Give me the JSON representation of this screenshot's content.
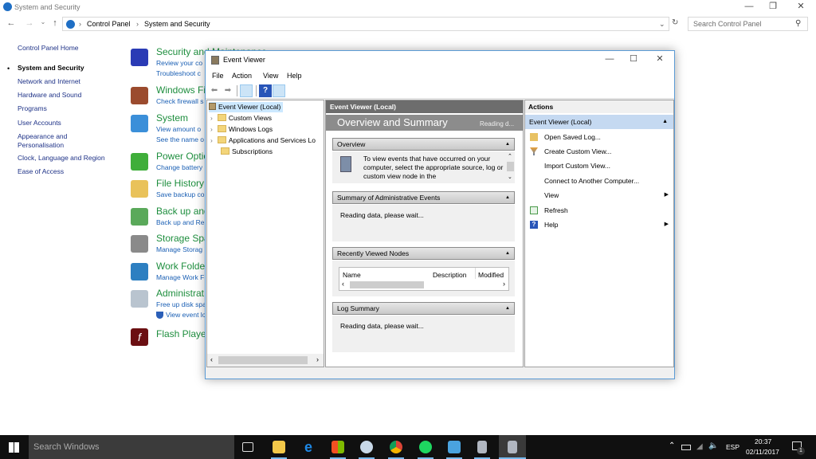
{
  "control_panel": {
    "window_title": "System and Security",
    "breadcrumb": [
      "Control Panel",
      "System and Security"
    ],
    "search_placeholder": "Search Control Panel",
    "left_nav": [
      {
        "label": "Control Panel Home",
        "selected": false
      },
      {
        "label": "System and Security",
        "selected": true
      },
      {
        "label": "Network and Internet",
        "selected": false
      },
      {
        "label": "Hardware and Sound",
        "selected": false
      },
      {
        "label": "Programs",
        "selected": false
      },
      {
        "label": "User Accounts",
        "selected": false
      },
      {
        "label": "Appearance and",
        "selected": false
      },
      {
        "label": "Personalisation",
        "selected": false
      },
      {
        "label": "Clock, Language and Region",
        "selected": false
      },
      {
        "label": "Ease of Access",
        "selected": false
      }
    ],
    "categories": [
      {
        "title": "Security and Maintenance",
        "links": [
          "Review your co",
          "Troubleshoot c"
        ]
      },
      {
        "title": "Windows Fi",
        "links": [
          "Check firewall s"
        ]
      },
      {
        "title": "System",
        "links": [
          "View amount o",
          "See the name o"
        ]
      },
      {
        "title": "Power Optio",
        "links": [
          "Change battery"
        ]
      },
      {
        "title": "File History",
        "links": [
          "Save backup co"
        ]
      },
      {
        "title": "Back up and",
        "links": [
          "Back up and Re"
        ]
      },
      {
        "title": "Storage Spa",
        "links": [
          "Manage Storag"
        ]
      },
      {
        "title": "Work Folde",
        "links": [
          "Manage Work F"
        ]
      },
      {
        "title": "Administrat",
        "links": [
          "Free up disk spa",
          "View event lo"
        ]
      },
      {
        "title": "Flash Player",
        "links": []
      }
    ]
  },
  "event_viewer": {
    "title": "Event Viewer",
    "menu": [
      "File",
      "Action",
      "View",
      "Help"
    ],
    "tree": [
      {
        "label": "Event Viewer (Local)",
        "expandable": false,
        "selected": true
      },
      {
        "label": "Custom Views",
        "expandable": true
      },
      {
        "label": "Windows Logs",
        "expandable": true
      },
      {
        "label": "Applications and Services Lo",
        "expandable": true
      },
      {
        "label": "Subscriptions",
        "expandable": false
      }
    ],
    "center": {
      "header": "Event Viewer (Local)",
      "banner_title": "Overview and Summary",
      "banner_status": "Reading d...",
      "sections": [
        {
          "title": "Overview",
          "body": "To view events that have occurred on your computer, select the appropriate source, log or custom view node in the"
        },
        {
          "title": "Summary of Administrative Events",
          "body": "Reading data, please wait..."
        },
        {
          "title": "Recently Viewed Nodes",
          "columns": [
            "Name",
            "Description",
            "Modified"
          ]
        },
        {
          "title": "Log Summary",
          "body": "Reading data, please wait..."
        }
      ]
    },
    "actions": {
      "header": "Actions",
      "group": "Event Viewer (Local)",
      "items": [
        {
          "label": "Open Saved Log...",
          "icon": "folder-open-icon",
          "submenu": false
        },
        {
          "label": "Create Custom View...",
          "icon": "filter-icon",
          "submenu": false
        },
        {
          "label": "Import Custom View...",
          "icon": "",
          "submenu": false
        },
        {
          "label": "Connect to Another Computer...",
          "icon": "",
          "submenu": false
        },
        {
          "label": "View",
          "icon": "",
          "submenu": true
        },
        {
          "label": "Refresh",
          "icon": "refresh-icon",
          "submenu": false
        },
        {
          "label": "Help",
          "icon": "help-icon",
          "submenu": true
        }
      ]
    }
  },
  "taskbar": {
    "search_placeholder": "Search Windows",
    "language": "ESP",
    "time": "20:37",
    "date": "02/11/2017",
    "notification_count": "1"
  }
}
